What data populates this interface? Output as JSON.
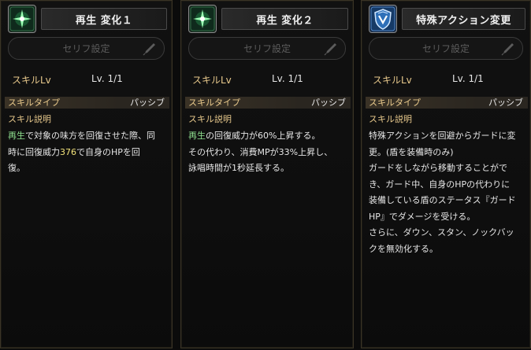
{
  "colors": {
    "accent_label": "#e8c98c",
    "highlight_green": "#8fe08f",
    "highlight_yellow": "#f2e27a"
  },
  "panels": [
    {
      "icon": "green-star-skill-icon",
      "title": "再生 変化１",
      "serif_button": "セリフ設定",
      "skill_lv_label": "スキルLv",
      "skill_lv_value": "Lv. 1/1",
      "skill_type_label": "スキルタイプ",
      "skill_type_value": "パッシブ",
      "desc_label": "スキル説明",
      "desc": {
        "l1_hl": "再生",
        "l1_rest": "で対象の味方を回復させた際、同",
        "l2_pre": "時に回復威力",
        "l2_num": "376",
        "l2_post": "で自身のHPを回",
        "l3": "復。"
      }
    },
    {
      "icon": "green-star-skill-icon",
      "title": "再生 変化２",
      "serif_button": "セリフ設定",
      "skill_lv_label": "スキルLv",
      "skill_lv_value": "Lv. 1/1",
      "skill_type_label": "スキルタイプ",
      "skill_type_value": "パッシブ",
      "desc_label": "スキル説明",
      "desc": {
        "l1_hl": "再生",
        "l1_rest": "の回復威力が60%上昇する。",
        "l2": "その代わり、消費MPが33%上昇し、",
        "l3": "詠唱時間が1秒延長する。"
      }
    },
    {
      "icon": "blue-shield-skill-icon",
      "title": "特殊アクション変更",
      "serif_button": "セリフ設定",
      "skill_lv_label": "スキルLv",
      "skill_lv_value": "Lv. 1/1",
      "skill_type_label": "スキルタイプ",
      "skill_type_value": "パッシブ",
      "desc_label": "スキル説明",
      "desc_lines": [
        "特殊アクションを回避からガードに変",
        "更。(盾を装備時のみ)",
        "ガードをしながら移動することがで",
        "き、ガード中、自身のHPの代わりに",
        "装備している盾のステータス『ガード",
        "HP』でダメージを受ける。",
        "さらに、ダウン、スタン、ノックバッ",
        "クを無効化する。"
      ]
    }
  ]
}
